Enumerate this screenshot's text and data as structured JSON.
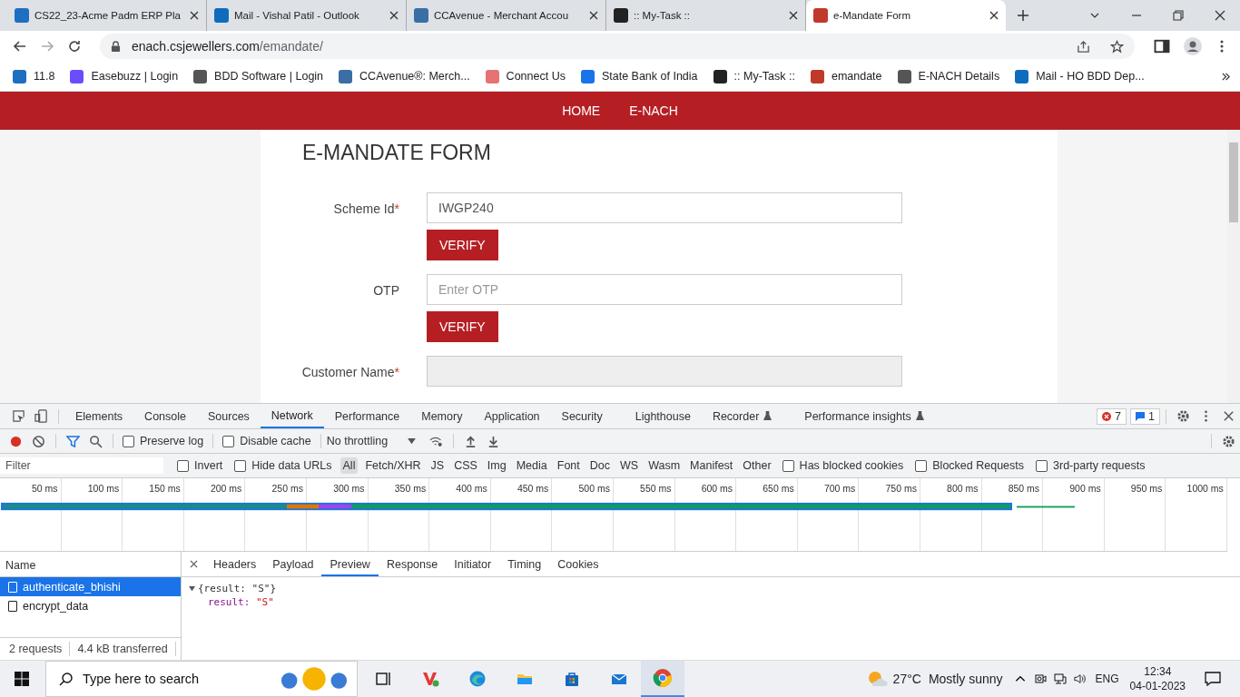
{
  "browser": {
    "tabs": [
      {
        "title": "CS22_23-Acme Padm ERP Pla",
        "selected": false
      },
      {
        "title": "Mail - Vishal Patil - Outlook",
        "selected": false
      },
      {
        "title": "CCAvenue - Merchant Accou",
        "selected": false
      },
      {
        "title": ":: My-Task ::",
        "selected": false
      },
      {
        "title": "e-Mandate Form",
        "selected": true
      }
    ],
    "url_host": "enach.csjewellers.com",
    "url_path": "/emandate/",
    "bookmarks": [
      {
        "label": "11.8"
      },
      {
        "label": "Easebuzz | Login"
      },
      {
        "label": "BDD Software | Login"
      },
      {
        "label": "CCAvenue®: Merch..."
      },
      {
        "label": "Connect Us"
      },
      {
        "label": "State Bank of India"
      },
      {
        "label": ":: My-Task ::"
      },
      {
        "label": "emandate"
      },
      {
        "label": "E-NACH Details"
      },
      {
        "label": "Mail - HO BDD Dep..."
      }
    ]
  },
  "nav": [
    {
      "label": "HOME"
    },
    {
      "label": "E-NACH"
    }
  ],
  "form": {
    "title": "E-MANDATE FORM",
    "required_mark": "*",
    "fields": [
      {
        "label": "Scheme Id",
        "required": true,
        "kind": "text",
        "value": "IWGP240",
        "button": "VERIFY"
      },
      {
        "label": "OTP",
        "required": false,
        "kind": "text",
        "placeholder": "Enter OTP",
        "button": "VERIFY"
      },
      {
        "label": "Customer Name",
        "required": true,
        "kind": "disabled"
      }
    ]
  },
  "devtools": {
    "tabs": [
      {
        "label": "Elements",
        "selected": false,
        "experimental": false
      },
      {
        "label": "Console",
        "selected": false,
        "experimental": false
      },
      {
        "label": "Sources",
        "selected": false,
        "experimental": false
      },
      {
        "label": "Network",
        "selected": true,
        "experimental": false
      },
      {
        "label": "Performance",
        "selected": false,
        "experimental": false
      },
      {
        "label": "Memory",
        "selected": false,
        "experimental": false
      },
      {
        "label": "Application",
        "selected": false,
        "experimental": false
      },
      {
        "label": "Security",
        "selected": false,
        "experimental": false
      },
      {
        "label": "Lighthouse",
        "selected": false,
        "experimental": false
      },
      {
        "label": "Recorder",
        "selected": false,
        "experimental": true
      },
      {
        "label": "Performance insights",
        "selected": false,
        "experimental": true
      }
    ],
    "error_count": "7",
    "message_count": "1",
    "toolbar": {
      "options": [
        {
          "label": "Preserve log",
          "checked": false
        },
        {
          "label": "Disable cache",
          "checked": false
        }
      ],
      "throttling": "No throttling"
    },
    "filter": {
      "placeholder": "Filter",
      "options": [
        {
          "label": "Invert",
          "checked": false
        },
        {
          "label": "Hide data URLs",
          "checked": false
        }
      ],
      "types": [
        {
          "label": "All",
          "selected": true
        },
        {
          "label": "Fetch/XHR",
          "selected": false
        },
        {
          "label": "JS",
          "selected": false
        },
        {
          "label": "CSS",
          "selected": false
        },
        {
          "label": "Img",
          "selected": false
        },
        {
          "label": "Media",
          "selected": false
        },
        {
          "label": "Font",
          "selected": false
        },
        {
          "label": "Doc",
          "selected": false
        },
        {
          "label": "WS",
          "selected": false
        },
        {
          "label": "Wasm",
          "selected": false
        },
        {
          "label": "Manifest",
          "selected": false
        },
        {
          "label": "Other",
          "selected": false
        }
      ],
      "more_options": [
        {
          "label": "Has blocked cookies",
          "checked": false
        },
        {
          "label": "Blocked Requests",
          "checked": false
        },
        {
          "label": "3rd-party requests",
          "checked": false
        }
      ]
    },
    "timeline_ticks": [
      "50 ms",
      "100 ms",
      "150 ms",
      "200 ms",
      "250 ms",
      "300 ms",
      "350 ms",
      "400 ms",
      "450 ms",
      "500 ms",
      "550 ms",
      "600 ms",
      "650 ms",
      "700 ms",
      "750 ms",
      "800 ms",
      "850 ms",
      "900 ms",
      "950 ms",
      "1000 ms"
    ],
    "name_header": "Name",
    "requests": [
      {
        "name": "authenticate_bhishi",
        "selected": true
      },
      {
        "name": "encrypt_data",
        "selected": false
      }
    ],
    "detail_tabs": [
      {
        "label": "Headers",
        "selected": false
      },
      {
        "label": "Payload",
        "selected": false
      },
      {
        "label": "Preview",
        "selected": true
      },
      {
        "label": "Response",
        "selected": false
      },
      {
        "label": "Initiator",
        "selected": false
      },
      {
        "label": "Timing",
        "selected": false
      },
      {
        "label": "Cookies",
        "selected": false
      }
    ],
    "preview": {
      "summary": "{result: \"S\"}",
      "key": "result:",
      "value": "\"S\""
    },
    "status": {
      "requests": "2 requests",
      "transferred": "4.4 kB transferred"
    }
  },
  "taskbar": {
    "search_placeholder": "Type here to search",
    "temperature": "27°C",
    "weather": "Mostly sunny",
    "language": "ENG",
    "time": "12:34",
    "date": "04-01-2023"
  }
}
